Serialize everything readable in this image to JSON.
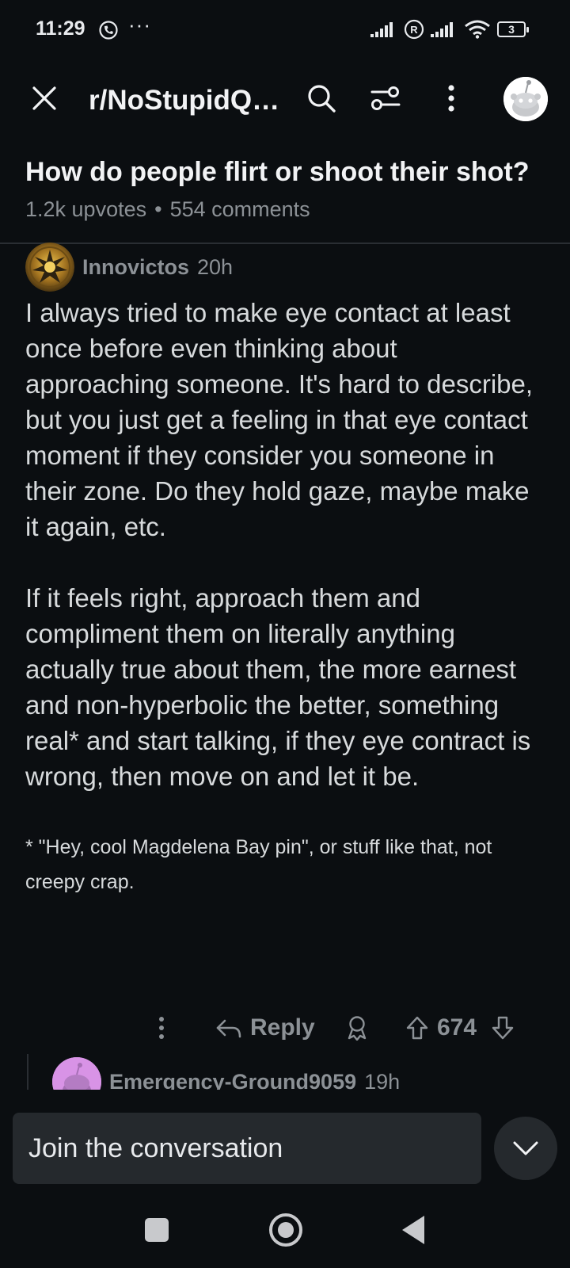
{
  "status_bar": {
    "time": "11:29",
    "overflow": "···",
    "battery": "3",
    "icons": [
      "viber-icon",
      "signal-icon",
      "roaming-icon",
      "signal-icon",
      "wifi-icon",
      "battery-icon"
    ]
  },
  "app_bar": {
    "subreddit": "r/NoStupidQuestions",
    "icons": [
      "close-icon",
      "search-icon",
      "filter-icon",
      "more-vertical-icon",
      "user-avatar"
    ]
  },
  "post": {
    "title": "How do people flirt or shoot their shot?",
    "upvotes": "1.2k upvotes",
    "separator": "•",
    "comments": "554 comments"
  },
  "comment": {
    "author": "Innovictos",
    "age": "20h",
    "paragraphs": [
      "I always tried to make eye contact at least once before even thinking about approaching someone. It's hard to describe, but you just get a feeling in that eye contact moment if they consider you someone in their zone. Do they hold gaze, maybe make it again, etc.",
      "If it feels right, approach them and compliment them on literally anything actually true about them, the more earnest and non-hyperbolic the better, something real* and start talking, if they eye contract is wrong, then move on and let it be."
    ],
    "footnote": "* \"Hey, cool Magdelena Bay pin\", or stuff like that, not creepy crap.",
    "actions": {
      "reply_label": "Reply",
      "score": "674"
    }
  },
  "reply": {
    "author": "Emergency-Ground9059",
    "age": "19h"
  },
  "composer": {
    "placeholder": "Join the conversation"
  },
  "colors": {
    "background": "#0b0e11",
    "text": "#d7dadc",
    "muted": "#8c9196",
    "surface": "#25292d"
  }
}
